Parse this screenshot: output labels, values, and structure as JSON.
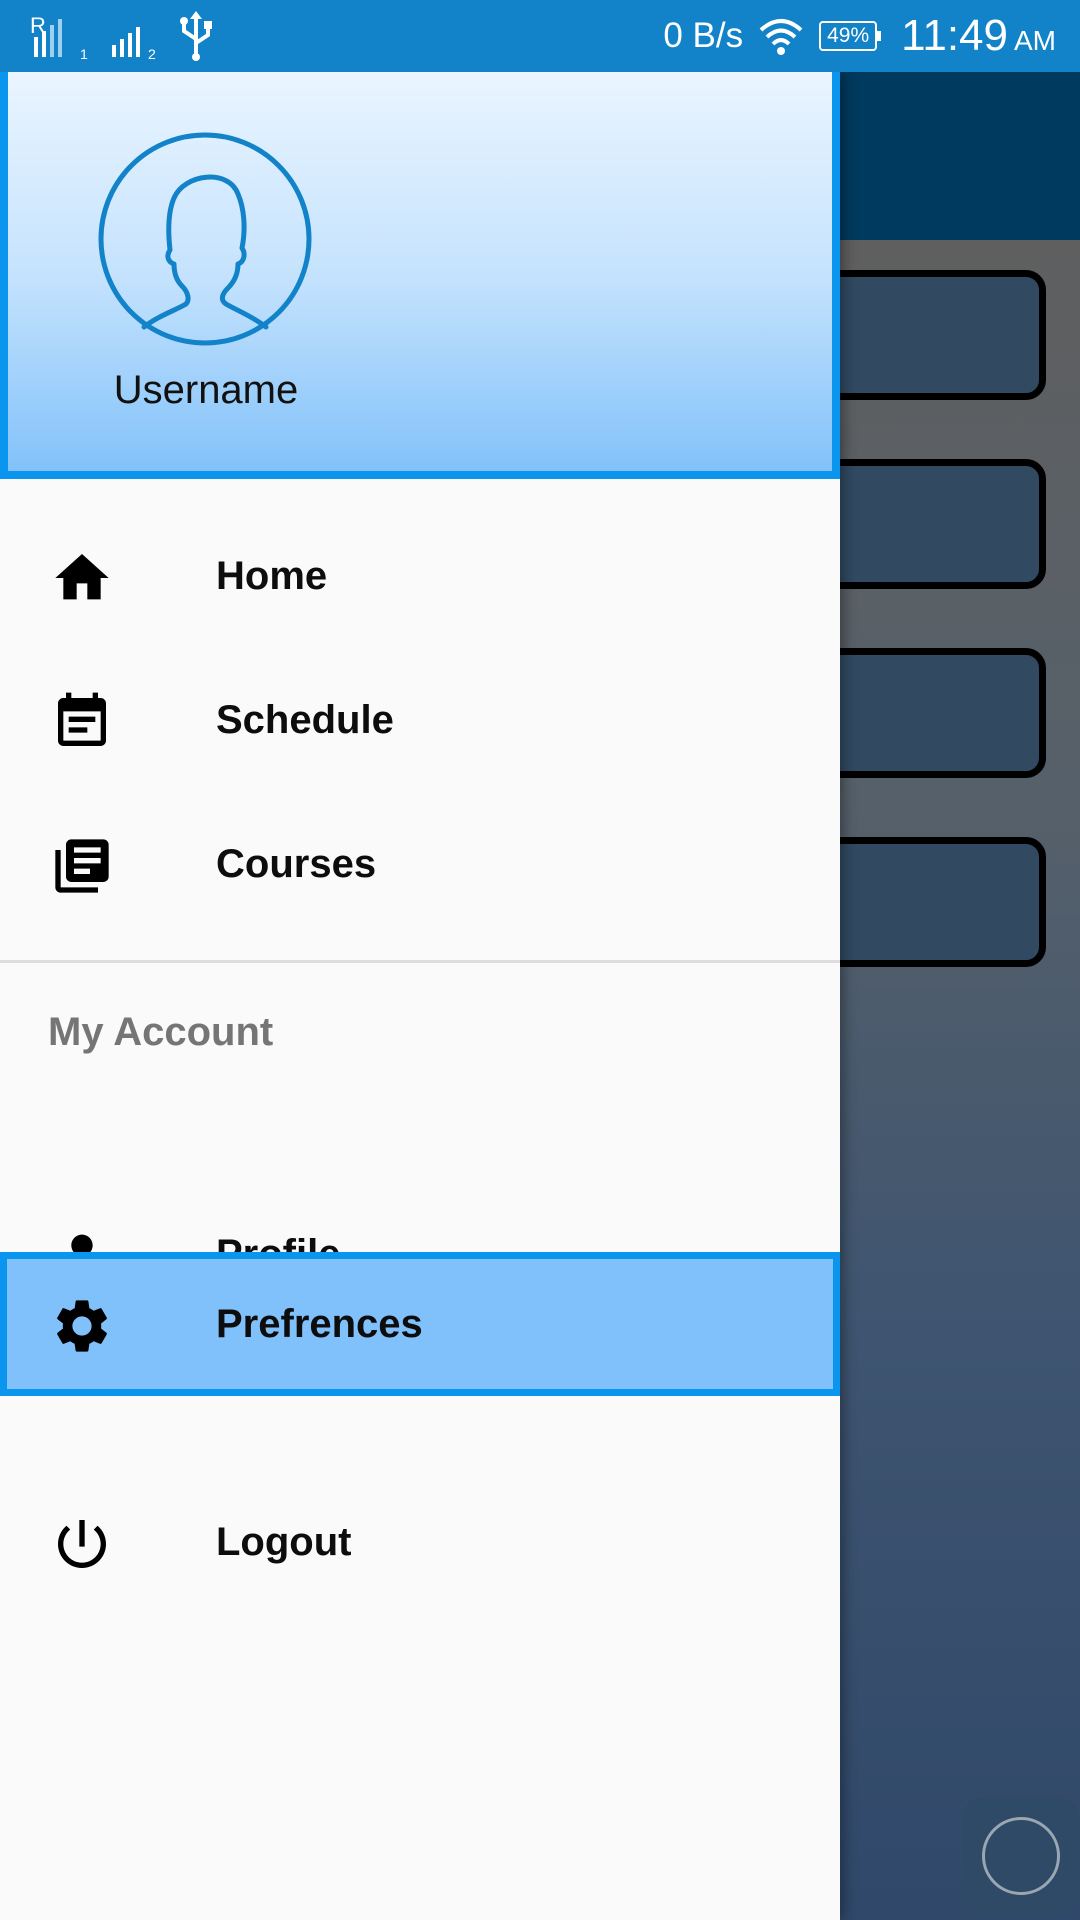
{
  "status_bar": {
    "net_speed": "0 B/s",
    "battery": "49%",
    "time": "11:49",
    "ampm": "AM",
    "signal_1_label": "1",
    "signal_2_label": "2",
    "roaming": "R"
  },
  "drawer": {
    "username": "Username",
    "menu": [
      {
        "label": "Home",
        "icon": "home-icon"
      },
      {
        "label": "Schedule",
        "icon": "schedule-icon"
      },
      {
        "label": "Courses",
        "icon": "courses-icon"
      }
    ],
    "account_section_title": "My Account",
    "account_menu": [
      {
        "label": "Profile",
        "icon": "person-icon"
      },
      {
        "label": "Prefrences",
        "icon": "gear-icon",
        "selected": true
      },
      {
        "label": "Logout",
        "icon": "power-icon"
      }
    ]
  },
  "colors": {
    "status_bar": "#1283c8",
    "header_border": "#0a96ee",
    "selected_bg": "#80c0fb",
    "app_bar": "#003a5e"
  }
}
